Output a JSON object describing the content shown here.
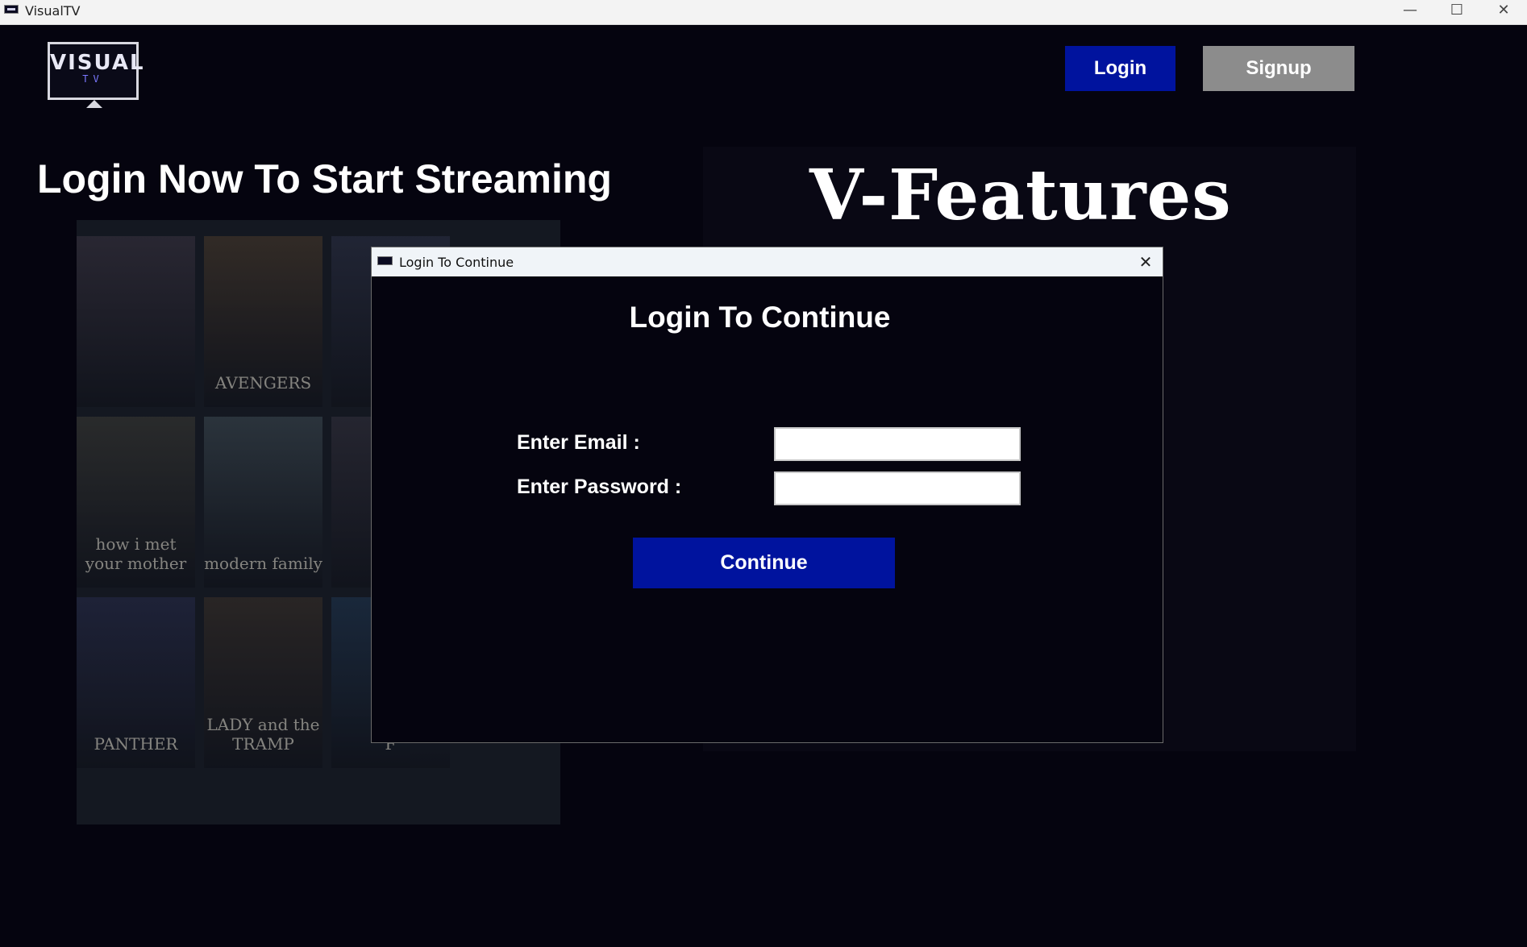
{
  "window": {
    "title": "VisualTV",
    "minimize_glyph": "—",
    "maximize_glyph": "☐",
    "close_glyph": "✕"
  },
  "logo": {
    "line1": "VISUAL",
    "line2": "TV"
  },
  "nav": {
    "login_label": "Login",
    "signup_label": "Signup"
  },
  "hero": {
    "title": "Login Now To Start Streaming"
  },
  "features": {
    "title": "V-Features"
  },
  "collage": {
    "posters": [
      {
        "text": "",
        "color": "#3a3340"
      },
      {
        "text": "AVENGERS",
        "color": "#4a3a2a"
      },
      {
        "text": "",
        "color": "#2b2f44"
      },
      {
        "text": "how i met your mother",
        "color": "#3b3a34"
      },
      {
        "text": "modern family",
        "color": "#3d4a52"
      },
      {
        "text": "",
        "color": "#33303c"
      },
      {
        "text": "PANTHER",
        "color": "#262a4a"
      },
      {
        "text": "LADY and the TRAMP",
        "color": "#3a3028"
      },
      {
        "text": "F",
        "color": "#1e3550"
      }
    ]
  },
  "dialog": {
    "title": "Login To Continue",
    "heading": "Login To Continue",
    "close_glyph": "✕",
    "email_label": "Enter Email :",
    "email_value": "",
    "password_label": "Enter Password :",
    "password_value": "",
    "continue_label": "Continue"
  },
  "colors": {
    "background": "#05040f",
    "primary_button": "#00139e",
    "secondary_button": "#8c8c8c"
  }
}
